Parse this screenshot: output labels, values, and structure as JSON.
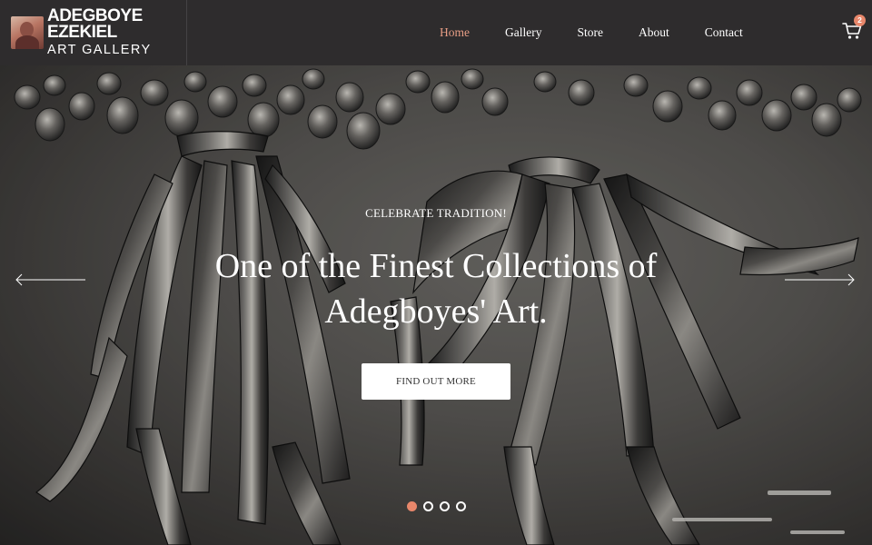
{
  "brand": {
    "line1": "ADEGBOYE",
    "line2": "EZEKIEL",
    "line3": "ART GALLERY"
  },
  "nav": {
    "items": [
      {
        "label": "Home",
        "active": true
      },
      {
        "label": "Gallery",
        "active": false
      },
      {
        "label": "Store",
        "active": false
      },
      {
        "label": "About",
        "active": false
      },
      {
        "label": "Contact",
        "active": false
      }
    ]
  },
  "cart": {
    "count": "2",
    "icon": "cart-icon"
  },
  "hero": {
    "kicker": "CELEBRATE TRADITION!",
    "title": "One of the Finest Collections of Adegboyes' Art.",
    "button_label": "FIND OUT MORE",
    "slides_total": 4,
    "active_slide": 1
  },
  "colors": {
    "header_bg": "#2e2c2d",
    "accent": "#e8876b",
    "nav_active": "#e89e85",
    "text": "#ffffff"
  }
}
